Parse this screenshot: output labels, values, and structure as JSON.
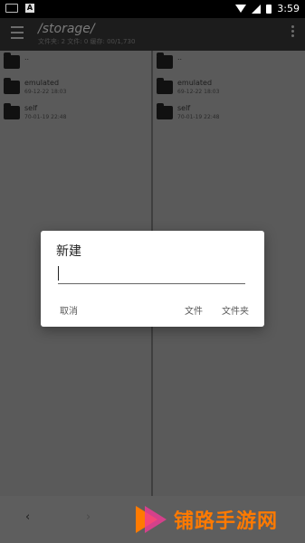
{
  "status_bar": {
    "time": "3:59"
  },
  "toolbar": {
    "path": "/storage/",
    "subtitle": "文件夹: 2  文件: 0  缓存: 00/1,730"
  },
  "left_pane": {
    "items": [
      {
        "name": "..",
        "date": ""
      },
      {
        "name": "emulated",
        "date": "69-12-22 18:03"
      },
      {
        "name": "self",
        "date": "70-01-19 22:48"
      }
    ]
  },
  "right_pane": {
    "items": [
      {
        "name": "..",
        "date": ""
      },
      {
        "name": "emulated",
        "date": "69-12-22 18:03"
      },
      {
        "name": "self",
        "date": "70-01-19 22:48"
      }
    ]
  },
  "dialog": {
    "title": "新建",
    "input_value": "",
    "cancel_label": "取消",
    "file_label": "文件",
    "folder_label": "文件夹"
  },
  "bottom_bar": {
    "back": "‹",
    "forward": "›"
  },
  "watermark": {
    "text": "铺路手游网"
  }
}
